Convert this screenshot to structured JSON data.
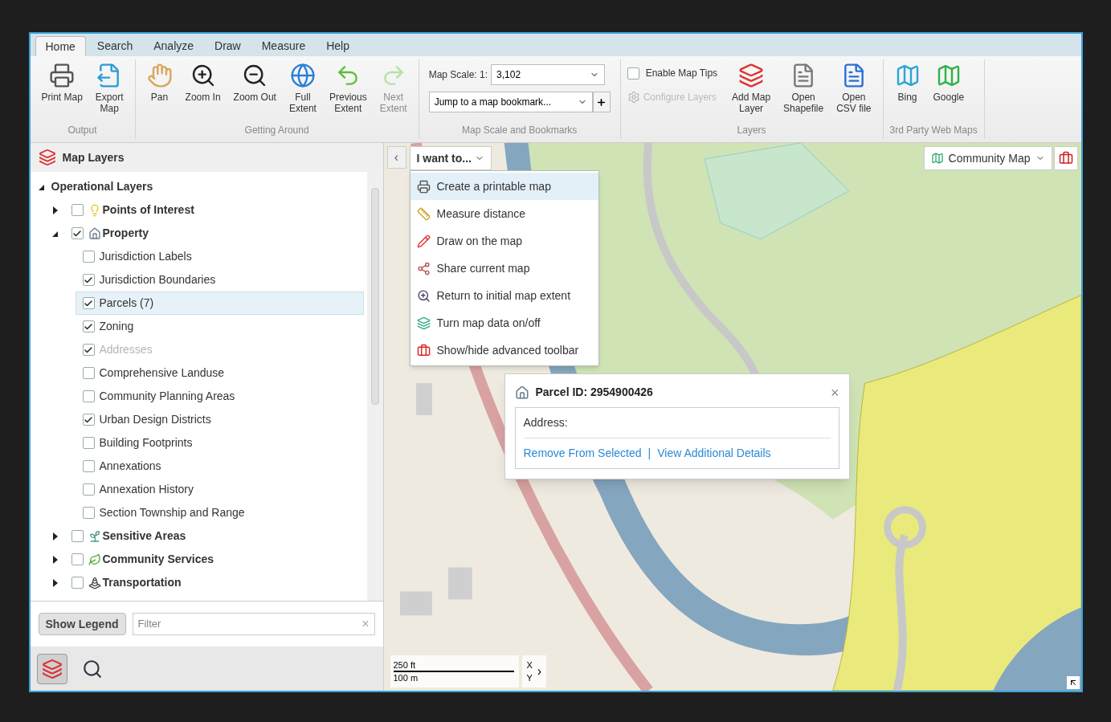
{
  "tabs": [
    {
      "label": "Home",
      "selected": true
    },
    {
      "label": "Search",
      "selected": false
    },
    {
      "label": "Analyze",
      "selected": false
    },
    {
      "label": "Draw",
      "selected": false
    },
    {
      "label": "Measure",
      "selected": false
    },
    {
      "label": "Help",
      "selected": false
    }
  ],
  "ribbon": {
    "groups": [
      {
        "kind": "buttons",
        "title": "Output",
        "buttons": [
          {
            "label": "Print Map",
            "disabled": false
          },
          {
            "label": "Export\nMap",
            "disabled": false
          }
        ]
      },
      {
        "kind": "buttons",
        "title": "Getting Around",
        "buttons": [
          {
            "label": "Pan",
            "disabled": false
          },
          {
            "label": "Zoom In",
            "disabled": false
          },
          {
            "label": "Zoom Out",
            "disabled": false
          },
          {
            "label": "Full\nExtent",
            "disabled": false
          },
          {
            "label": "Previous\nExtent",
            "disabled": false
          },
          {
            "label": "Next\nExtent",
            "disabled": true
          }
        ]
      },
      {
        "kind": "scale",
        "title": "Map Scale and Bookmarks",
        "scale_label": "Map Scale: 1:",
        "scale_value": "3,102",
        "bookmark_value": "Jump to a map bookmark..."
      },
      {
        "kind": "layers",
        "title": "Layers",
        "map_tips": {
          "label": "Enable Map Tips",
          "checked": false
        },
        "configure": {
          "label": "Configure Layers",
          "disabled": true
        },
        "buttons": [
          {
            "label": "Add Map\nLayer",
            "disabled": false
          },
          {
            "label": "Open\nShapefile",
            "disabled": false
          },
          {
            "label": "Open\nCSV file",
            "disabled": false
          }
        ]
      },
      {
        "kind": "buttons",
        "title": "3rd Party Web Maps",
        "buttons": [
          {
            "label": "Bing",
            "disabled": false
          },
          {
            "label": "Google",
            "disabled": false
          }
        ]
      }
    ]
  },
  "layers": {
    "title": "Map Layers",
    "tree": {
      "label": "Operational Layers",
      "expanded": true,
      "children": [
        {
          "label": "Points of Interest",
          "expanded": false,
          "checked": false,
          "selected": false,
          "disabled": false
        },
        {
          "label": "Property",
          "expanded": true,
          "checked": true,
          "selected": false,
          "disabled": false,
          "children": [
            {
              "label": "Jurisdiction Labels",
              "checked": false,
              "selected": false,
              "disabled": false
            },
            {
              "label": "Jurisdiction Boundaries",
              "checked": true,
              "selected": false,
              "disabled": false
            },
            {
              "label": "Parcels (7)",
              "checked": true,
              "selected": true,
              "disabled": false
            },
            {
              "label": "Zoning",
              "checked": true,
              "selected": false,
              "disabled": false
            },
            {
              "label": "Addresses",
              "checked": true,
              "selected": false,
              "disabled": true
            },
            {
              "label": "Comprehensive Landuse",
              "checked": false,
              "selected": false,
              "disabled": false
            },
            {
              "label": "Community Planning Areas",
              "checked": false,
              "selected": false,
              "disabled": false
            },
            {
              "label": "Urban Design Districts",
              "checked": true,
              "selected": false,
              "disabled": false
            },
            {
              "label": "Building Footprints",
              "checked": false,
              "selected": false,
              "disabled": false
            },
            {
              "label": "Annexations",
              "checked": false,
              "selected": false,
              "disabled": false
            },
            {
              "label": "Annexation History",
              "checked": false,
              "selected": false,
              "disabled": false
            },
            {
              "label": "Section Township and Range",
              "checked": false,
              "selected": false,
              "disabled": false
            }
          ]
        },
        {
          "label": "Sensitive Areas",
          "expanded": false,
          "checked": false,
          "selected": false,
          "disabled": false
        },
        {
          "label": "Community Services",
          "expanded": false,
          "checked": false,
          "selected": false,
          "disabled": false
        },
        {
          "label": "Transportation",
          "expanded": false,
          "checked": false,
          "selected": false,
          "disabled": false
        }
      ]
    },
    "legend_button": "Show Legend",
    "filter_placeholder": "Filter",
    "filter_clear": "×"
  },
  "bottom_tabs": [
    {
      "selected": true
    },
    {
      "selected": false
    }
  ],
  "map": {
    "back": "‹",
    "menu_button": "I want to...",
    "menu": [
      {
        "label": "Create a printable map",
        "selected": true
      },
      {
        "label": "Measure distance",
        "selected": false
      },
      {
        "label": "Draw on the map",
        "selected": false
      },
      {
        "label": "Share current map",
        "selected": false
      },
      {
        "label": "Return to initial map extent",
        "selected": false
      },
      {
        "label": "Turn map data on/off",
        "selected": false
      },
      {
        "label": "Show/hide advanced toolbar",
        "selected": false
      }
    ],
    "basemap": "Community Map",
    "popup": {
      "title": "Parcel ID: 2954900426",
      "close": "×",
      "address_label": "Address:",
      "links": [
        "Remove From Selected",
        "View Additional Details"
      ],
      "separator": "|"
    },
    "scale": {
      "feet": "250 ft",
      "meters": "100 m",
      "x": "X",
      "y": "Y",
      "arrow": "›"
    }
  }
}
